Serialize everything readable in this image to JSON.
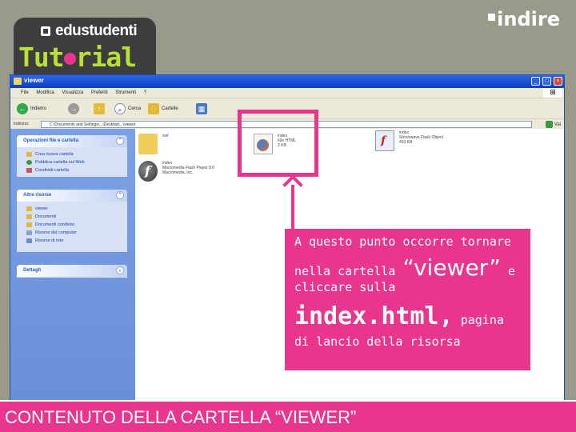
{
  "branding": {
    "logo_top": "edustudenti",
    "logo_bottom_a": "Tut",
    "logo_bottom_b": "rial",
    "right_logo": "indire"
  },
  "window": {
    "title": "viewer",
    "controls": [
      "_",
      "□",
      "×"
    ],
    "menu": [
      "File",
      "Modifica",
      "Visualizza",
      "Preferiti",
      "Strumenti",
      "?"
    ],
    "toolbar": {
      "back": "Indietro",
      "search": "Cerca",
      "folders": "Cartelle"
    },
    "address_label": "Indirizzo",
    "address_value": "C:\\Documents and Settings\\...\\Desktop\\...\\viewer",
    "go_label": "Vai"
  },
  "task_pane": {
    "file_tasks": {
      "title": "Operazioni file e cartella",
      "items": [
        "Crea nuova cartella",
        "Pubblica cartella sul Web",
        "Condividi cartella"
      ]
    },
    "other_places": {
      "title": "Altre risorse",
      "items": [
        "viewer",
        "Documenti",
        "Documenti condivisi",
        "Risorse del computer",
        "Risorse di rete"
      ]
    },
    "details": {
      "title": "Dettagli"
    }
  },
  "files": [
    {
      "name": "swf",
      "type": "",
      "size": "",
      "icon": "folder-icon"
    },
    {
      "name": "index",
      "type": "File HTML",
      "size": "2 KB",
      "icon": "firefox-html-icon"
    },
    {
      "name": "index",
      "type": "Shockwave Flash Object",
      "size": "493 KB",
      "icon": "flash-file-icon"
    },
    {
      "name": "index",
      "type": "Macromedia Flash Player 8.0",
      "size": "Macromedia, Inc.",
      "icon": "flash-player-icon"
    }
  ],
  "callout": {
    "line1": "A questo punto occorre tornare",
    "line2_pre": "nella cartella ",
    "line2_big": "“viewer”",
    "line2_post": " e",
    "line3": "cliccare sulla",
    "line4_big": "index.html,",
    "line4_post": " pagina",
    "line5": "di lancio della risorsa"
  },
  "caption": "CONTENUTO DELLA CARTELLA “VIEWER”",
  "colors": {
    "accent": "#e8368f",
    "lime": "#b7e03b",
    "xp_blue": "#0c3fbf"
  }
}
